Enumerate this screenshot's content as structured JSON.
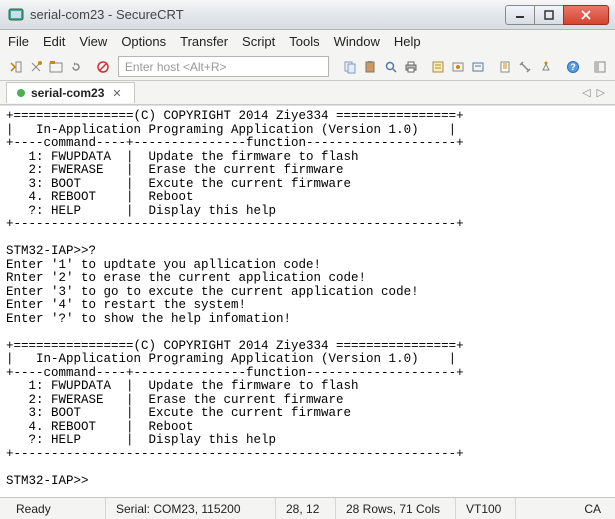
{
  "window": {
    "title": "serial-com23 - SecureCRT"
  },
  "menu": {
    "file": "File",
    "edit": "Edit",
    "view": "View",
    "options": "Options",
    "transfer": "Transfer",
    "script": "Script",
    "tools": "Tools",
    "window": "Window",
    "help": "Help"
  },
  "toolbar": {
    "host_placeholder": "Enter host <Alt+R>"
  },
  "tab": {
    "label": "serial-com23"
  },
  "terminal": {
    "text": "+================(C) COPYRIGHT 2014 Ziye334 ================+\n|   In-Application Programing Application (Version 1.0)    |\n+----command----+---------------function--------------------+\n   1: FWUPDATA  |  Update the firmware to flash\n   2: FWERASE   |  Erase the current firmware\n   3: BOOT      |  Excute the current firmware\n   4. REBOOT    |  Reboot\n   ?: HELP      |  Display this help\n+-----------------------------------------------------------+\n\nSTM32-IAP>>?\nEnter '1' to updtate you apllication code!\nRnter '2' to erase the current application code!\nEnter '3' to go to excute the current application code!\nEnter '4' to restart the system!\nEnter '?' to show the help infomation!\n\n+================(C) COPYRIGHT 2014 Ziye334 ================+\n|   In-Application Programing Application (Version 1.0)    |\n+----command----+---------------function--------------------+\n   1: FWUPDATA  |  Update the firmware to flash\n   2: FWERASE   |  Erase the current firmware\n   3: BOOT      |  Excute the current firmware\n   4. REBOOT    |  Reboot\n   ?: HELP      |  Display this help\n+-----------------------------------------------------------+\n\nSTM32-IAP>>"
  },
  "status": {
    "ready": "Ready",
    "serial": "Serial: COM23, 115200",
    "cursor": "28,  12",
    "size": "28 Rows, 71 Cols",
    "emu": "VT100",
    "caps": "CA"
  }
}
